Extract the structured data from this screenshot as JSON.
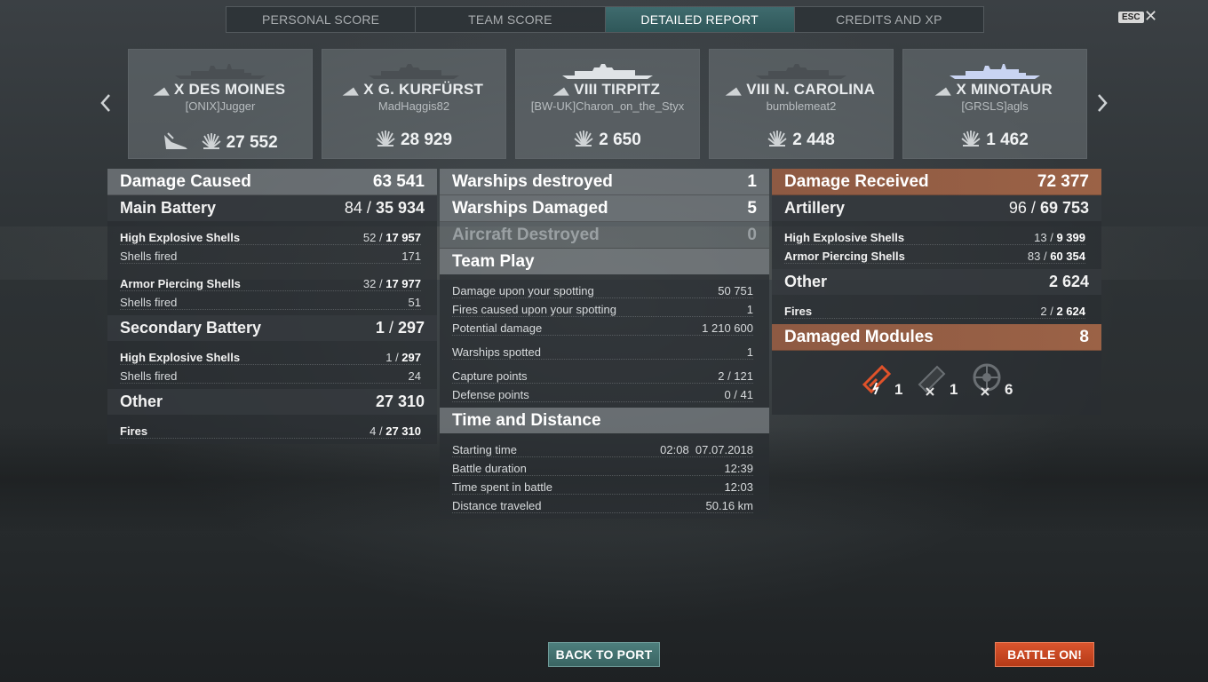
{
  "tabs": [
    {
      "label": "PERSONAL SCORE"
    },
    {
      "label": "TEAM SCORE"
    },
    {
      "label": "DETAILED REPORT"
    },
    {
      "label": "CREDITS AND XP"
    }
  ],
  "active_tab": "DETAILED REPORT",
  "esc_label": "ESC",
  "close_symbol": "✕",
  "nav": {
    "left": "‹",
    "right": "›"
  },
  "ships": [
    {
      "tier": "X",
      "name": "DES MOINES",
      "player": "[ONIX]Jugger",
      "damage": "27 552",
      "icon": "destroyed-ship-icon"
    },
    {
      "tier": "X",
      "name": "G. KURFÜRST",
      "player": "MadHaggis82",
      "damage": "28 929"
    },
    {
      "tier": "VIII",
      "name": "TIRPITZ",
      "player": "[BW-UK]Charon_on_the_Styx",
      "damage": "2 650"
    },
    {
      "tier": "VIII",
      "name": "N. CAROLINA",
      "player": "bumblemeat2",
      "damage": "2 448"
    },
    {
      "tier": "X",
      "name": "MINOTAUR",
      "player": "[GRSLS]agls",
      "damage": "1 462"
    }
  ],
  "damage_caused": {
    "title": "Damage Caused",
    "value": "63 541",
    "main_battery": {
      "title": "Main Battery",
      "hits": "84",
      "damage": "35 934",
      "he_label": "High Explosive Shells",
      "he_hits": "52",
      "he_damage": "17 957",
      "he_fired_label": "Shells fired",
      "he_fired": "171",
      "ap_label": "Armor Piercing Shells",
      "ap_hits": "32",
      "ap_damage": "17 977",
      "ap_fired_label": "Shells fired",
      "ap_fired": "51"
    },
    "secondary_battery": {
      "title": "Secondary Battery",
      "hits": "1",
      "damage": "297",
      "he_label": "High Explosive Shells",
      "he_hits": "1",
      "he_damage": "297",
      "fired_label": "Shells fired",
      "fired": "24"
    },
    "other": {
      "title": "Other",
      "value": "27 310",
      "fires_label": "Fires",
      "fires": "4",
      "fires_damage": "27 310"
    }
  },
  "middle": {
    "warships_destroyed": {
      "label": "Warships destroyed",
      "value": "1"
    },
    "warships_damaged": {
      "label": "Warships Damaged",
      "value": "5"
    },
    "aircraft_destroyed": {
      "label": "Aircraft Destroyed",
      "value": "0"
    },
    "team_play": {
      "title": "Team Play",
      "rows": [
        {
          "label": "Damage upon your spotting",
          "value": "50 751"
        },
        {
          "label": "Fires caused upon your spotting",
          "value": "1"
        },
        {
          "label": "Potential damage",
          "value": "1 210 600"
        },
        {
          "label": "Warships spotted",
          "value": "1"
        },
        {
          "label": "Capture points",
          "value": "2 / 121"
        },
        {
          "label": "Defense points",
          "value": "0 / 41"
        }
      ]
    },
    "time_distance": {
      "title": "Time and Distance",
      "rows": [
        {
          "label": "Starting time",
          "value": "02:08  07.07.2018"
        },
        {
          "label": "Battle duration",
          "value": "12:39"
        },
        {
          "label": "Time spent in battle",
          "value": "12:03"
        },
        {
          "label": "Distance traveled",
          "value": "50.16 km"
        }
      ]
    }
  },
  "damage_received": {
    "title": "Damage Received",
    "value": "72 377",
    "artillery": {
      "title": "Artillery",
      "hits": "96",
      "damage": "69 753",
      "he_label": "High Explosive Shells",
      "he_hits": "13",
      "he_damage": "9 399",
      "ap_label": "Armor Piercing Shells",
      "ap_hits": "83",
      "ap_damage": "60 354"
    },
    "other": {
      "title": "Other",
      "value": "2 624",
      "fires_label": "Fires",
      "fires": "2",
      "fires_damage": "2 624"
    },
    "damaged_modules": {
      "title": "Damaged Modules",
      "value": "8",
      "modules": [
        {
          "icon": "main-battery-damaged-icon",
          "count": "1"
        },
        {
          "icon": "torpedo-tube-destroyed-icon",
          "count": "1"
        },
        {
          "icon": "steering-gear-destroyed-icon",
          "count": "6"
        }
      ]
    }
  },
  "buttons": {
    "back_to_port": "BACK TO PORT",
    "battle_on": "BATTLE ON!"
  },
  "colors": {
    "accent_teal": "#3f6b6e",
    "received_orange": "#9b6246",
    "battle_button": "#c8461f"
  }
}
